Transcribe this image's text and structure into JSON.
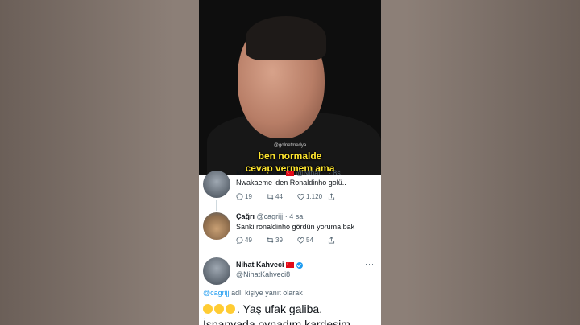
{
  "video": {
    "watermark": "@golnetmedya",
    "subtitle_line1": "ben normalde",
    "subtitle_line2": "cevap vermem ama"
  },
  "tweets": [
    {
      "name": "Nihat Kahveci",
      "handle": "@Nihat...",
      "time": "· 8s",
      "text": "Nwakaeme 'den Ronaldinho golü..",
      "replies": "19",
      "retweets": "44",
      "likes": "1.120"
    },
    {
      "name": "Çağrı",
      "handle": "@cagrijj",
      "time": "· 4 sa",
      "text": "Sanki ronaldinho gördün yoruma bak",
      "replies": "49",
      "retweets": "39",
      "likes": "54"
    },
    {
      "name": "Nihat Kahveci",
      "handle": "@NihatKahveci8",
      "reply_handle": "@cagrijj",
      "reply_suffix": "adlı kişiye yanıt olarak",
      "text_line1": ". Yaş ufak galiba.",
      "text_line2": "İspanyada oynadım kardeşim"
    }
  ],
  "icons": [
    "reply-icon",
    "retweet-icon",
    "like-icon",
    "share-icon",
    "more-icon",
    "verified-icon",
    "turkish-flag-icon"
  ],
  "colors": {
    "accent": "#1d9bf0",
    "subtitle": "#ffe62e"
  }
}
